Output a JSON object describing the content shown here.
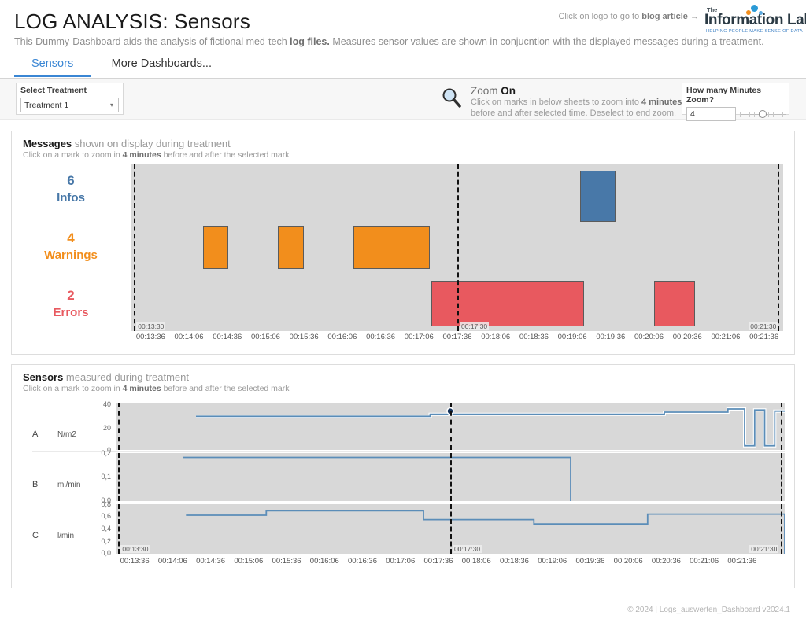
{
  "header": {
    "title": "LOG ANALYSIS: Sensors",
    "subtitle_1": "This Dummy-Dashboard aids the analysis of fictional med-tech ",
    "subtitle_bold": "log files.",
    "subtitle_2": " Measures sensor values are shown in conjucntion with the displayed messages during a treatment.",
    "logo_hint_1": "Click on logo to go to ",
    "logo_hint_bold": "blog article",
    "logo_hint_arrow": "→",
    "logo": {
      "the": "The",
      "name": "Information Lab",
      "tagline": "HELPING PEOPLE MAKE SENSE OF DATA"
    }
  },
  "tabs": [
    {
      "label": "Sensors",
      "active": true
    },
    {
      "label": "More Dashboards...",
      "active": false
    }
  ],
  "controls": {
    "treatment": {
      "label": "Select Treatment",
      "value": "Treatment 1",
      "caret": "▾"
    },
    "zoom": {
      "icon": "magnifier-icon",
      "title_1": "Zoom ",
      "title_bold": "On",
      "desc_1": "Click on marks in below sheets to zoom into ",
      "desc_bold": "4 minutes",
      "desc_2": "before and after selected time. Deselect to end zoom."
    },
    "minutes": {
      "label_1": "How many Minutes ",
      "label_2": "Zoom?",
      "value": "4"
    }
  },
  "messages_panel": {
    "title_bold": "Messages",
    "title_rest": " shown on display during treatment",
    "sub_1": "Click on a mark to zoom in ",
    "sub_bold": "4 minutes",
    "sub_2": " before and after the selected mark",
    "legend": [
      {
        "count": "6",
        "name": "Infos",
        "color": "#4878a8"
      },
      {
        "count": "4",
        "name": "Warnings",
        "color": "#f28e1c"
      },
      {
        "count": "2",
        "name": "Errors",
        "color": "#e8595f"
      }
    ],
    "range_start_label": "00:13:30",
    "range_mid_label": "00:17:30",
    "range_end_label": "00:21:30"
  },
  "sensors_panel": {
    "title_bold": "Sensors",
    "title_rest": " measured during treatment",
    "sub_1": "Click on a mark to zoom in ",
    "sub_bold": "4 minutes",
    "sub_2": " before and after the selected mark",
    "rows": [
      {
        "name": "A",
        "unit": "N/m2",
        "ticks": [
          "40",
          "20",
          "0"
        ]
      },
      {
        "name": "B",
        "unit": "ml/min",
        "ticks": [
          "0,2",
          "0,1",
          "0,0"
        ]
      },
      {
        "name": "C",
        "unit": "l/min",
        "ticks": [
          "0,8",
          "0,6",
          "0,4",
          "0,2",
          "0,0"
        ]
      }
    ],
    "range_start_label": "00:13:30",
    "range_mid_label": "00:17:30",
    "range_end_label": "00:21:30"
  },
  "axis_ticks": [
    "00:13:36",
    "00:14:06",
    "00:14:36",
    "00:15:06",
    "00:15:36",
    "00:16:06",
    "00:16:36",
    "00:17:06",
    "00:17:36",
    "00:18:06",
    "00:18:36",
    "00:19:06",
    "00:19:36",
    "00:20:06",
    "00:20:36",
    "00:21:06",
    "00:21:36"
  ],
  "footer": "© 2024 | Logs_auswerten_Dashboard v2024.1",
  "chart_data": [
    {
      "type": "bar",
      "name": "messages-gantt",
      "title": "Messages shown on display during treatment",
      "xlabel": "",
      "ylabel": "",
      "xlim": [
        "00:13:30",
        "00:21:36"
      ],
      "grid": false,
      "legend": "left",
      "reference_lines": [
        "00:13:30",
        "00:17:30",
        "00:21:30"
      ],
      "series": [
        {
          "name": "Infos",
          "color": "#4878a8",
          "bars": [
            {
              "start_pct": 68.8,
              "width_pct": 5.5,
              "lane": "info"
            }
          ]
        },
        {
          "name": "Warnings",
          "color": "#f28e1c",
          "bars": [
            {
              "start_pct": 11.0,
              "width_pct": 3.9,
              "lane": "warning"
            },
            {
              "start_pct": 22.5,
              "width_pct": 3.9,
              "lane": "warning"
            },
            {
              "start_pct": 34.0,
              "width_pct": 11.8,
              "lane": "warning"
            }
          ]
        },
        {
          "name": "Errors",
          "color": "#e8595f",
          "bars": [
            {
              "start_pct": 46.0,
              "width_pct": 23.5,
              "lane": "error"
            },
            {
              "start_pct": 80.2,
              "width_pct": 6.3,
              "lane": "error"
            }
          ]
        }
      ]
    },
    {
      "type": "line",
      "name": "sensor-A",
      "ylabel": "N/m2",
      "ylim": [
        0,
        45
      ],
      "yticks": [
        0,
        20,
        40
      ],
      "grid": false,
      "color": "#5b8db8",
      "marker": {
        "x_pct": 50.0,
        "y": 37,
        "label": "00:17:30"
      },
      "points": [
        [
          0,
          null
        ],
        [
          12.0,
          32
        ],
        [
          12.0,
          32
        ],
        [
          47.0,
          32
        ],
        [
          47.0,
          34
        ],
        [
          82.0,
          34
        ],
        [
          82.0,
          36
        ],
        [
          91.5,
          36
        ],
        [
          91.5,
          39
        ],
        [
          94.0,
          39
        ],
        [
          94.0,
          4
        ],
        [
          95.5,
          4
        ],
        [
          95.5,
          38
        ],
        [
          97.0,
          38
        ],
        [
          97.0,
          4
        ],
        [
          98.5,
          4
        ],
        [
          98.5,
          37
        ],
        [
          100,
          37
        ]
      ]
    },
    {
      "type": "line",
      "name": "sensor-B",
      "ylabel": "ml/min",
      "ylim": [
        0.0,
        0.22
      ],
      "yticks": [
        0.0,
        0.1,
        0.2
      ],
      "grid": false,
      "color": "#5b8db8",
      "points": [
        [
          10.0,
          0.2
        ],
        [
          68.0,
          0.2
        ],
        [
          68.0,
          0.0
        ]
      ]
    },
    {
      "type": "line",
      "name": "sensor-C",
      "ylabel": "l/min",
      "ylim": [
        0.0,
        0.9
      ],
      "yticks": [
        0.0,
        0.2,
        0.4,
        0.6,
        0.8
      ],
      "grid": false,
      "color": "#5b8db8",
      "points": [
        [
          10.5,
          0.7
        ],
        [
          22.5,
          0.7
        ],
        [
          22.5,
          0.78
        ],
        [
          46.0,
          0.78
        ],
        [
          46.0,
          0.62
        ],
        [
          62.5,
          0.62
        ],
        [
          62.5,
          0.54
        ],
        [
          79.5,
          0.54
        ],
        [
          79.5,
          0.72
        ],
        [
          100.0,
          0.72
        ],
        [
          100.0,
          0.0
        ]
      ]
    }
  ]
}
